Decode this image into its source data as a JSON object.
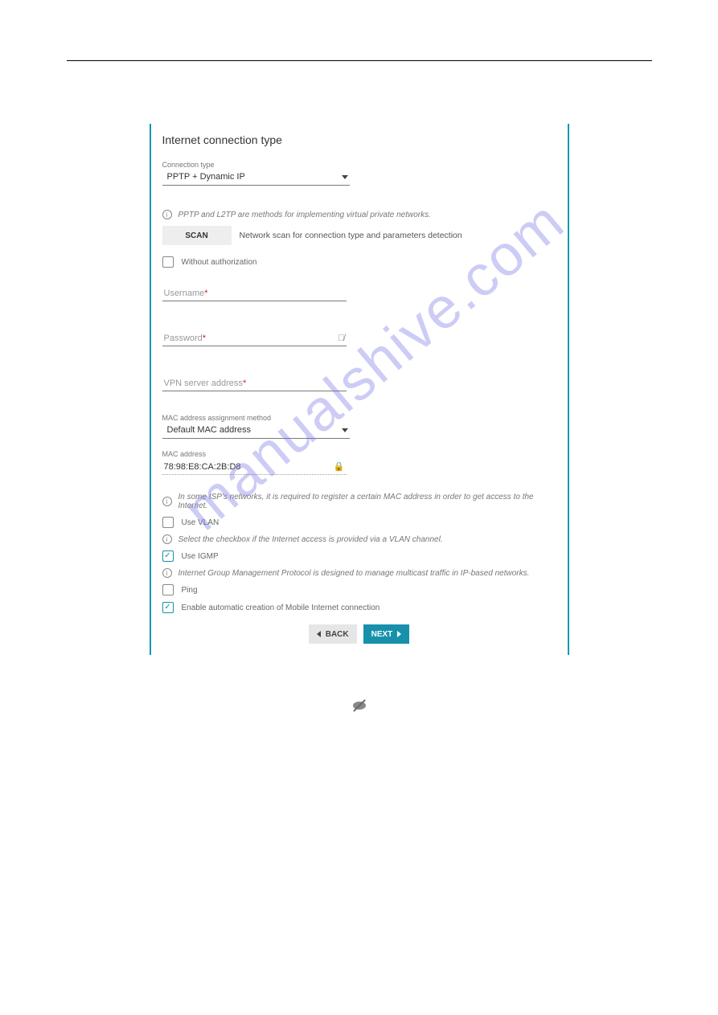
{
  "panel": {
    "title": "Internet connection type",
    "connection": {
      "label": "Connection type",
      "value": "PPTP + Dynamic IP"
    },
    "info_vpn": "PPTP and L2TP are methods for implementing virtual private networks.",
    "scan": {
      "button": "SCAN",
      "text": "Network scan for connection type and parameters detection"
    },
    "without_auth": {
      "label": "Without authorization",
      "checked": false
    },
    "username": {
      "placeholder": "Username",
      "value": ""
    },
    "password": {
      "placeholder": "Password",
      "value": ""
    },
    "vpn_server": {
      "placeholder": "VPN server address",
      "value": ""
    },
    "mac_method": {
      "label": "MAC address assignment method",
      "value": "Default MAC address"
    },
    "mac_addr": {
      "label": "MAC address",
      "value": "78:98:E8:CA:2B:D8"
    },
    "info_mac": "In some ISP's networks, it is required to register a certain MAC address in order to get access to the Internet.",
    "use_vlan": {
      "label": "Use VLAN",
      "checked": false
    },
    "info_vlan": "Select the checkbox if the Internet access is provided via a VLAN channel.",
    "use_igmp": {
      "label": "Use IGMP",
      "checked": true
    },
    "info_igmp": "Internet Group Management Protocol is designed to manage multicast traffic in IP-based networks.",
    "ping": {
      "label": "Ping",
      "checked": false
    },
    "auto_mobile": {
      "label": "Enable automatic creation of Mobile Internet connection",
      "checked": true
    },
    "back": "BACK",
    "next": "NEXT"
  },
  "watermark": "manualshive.com"
}
